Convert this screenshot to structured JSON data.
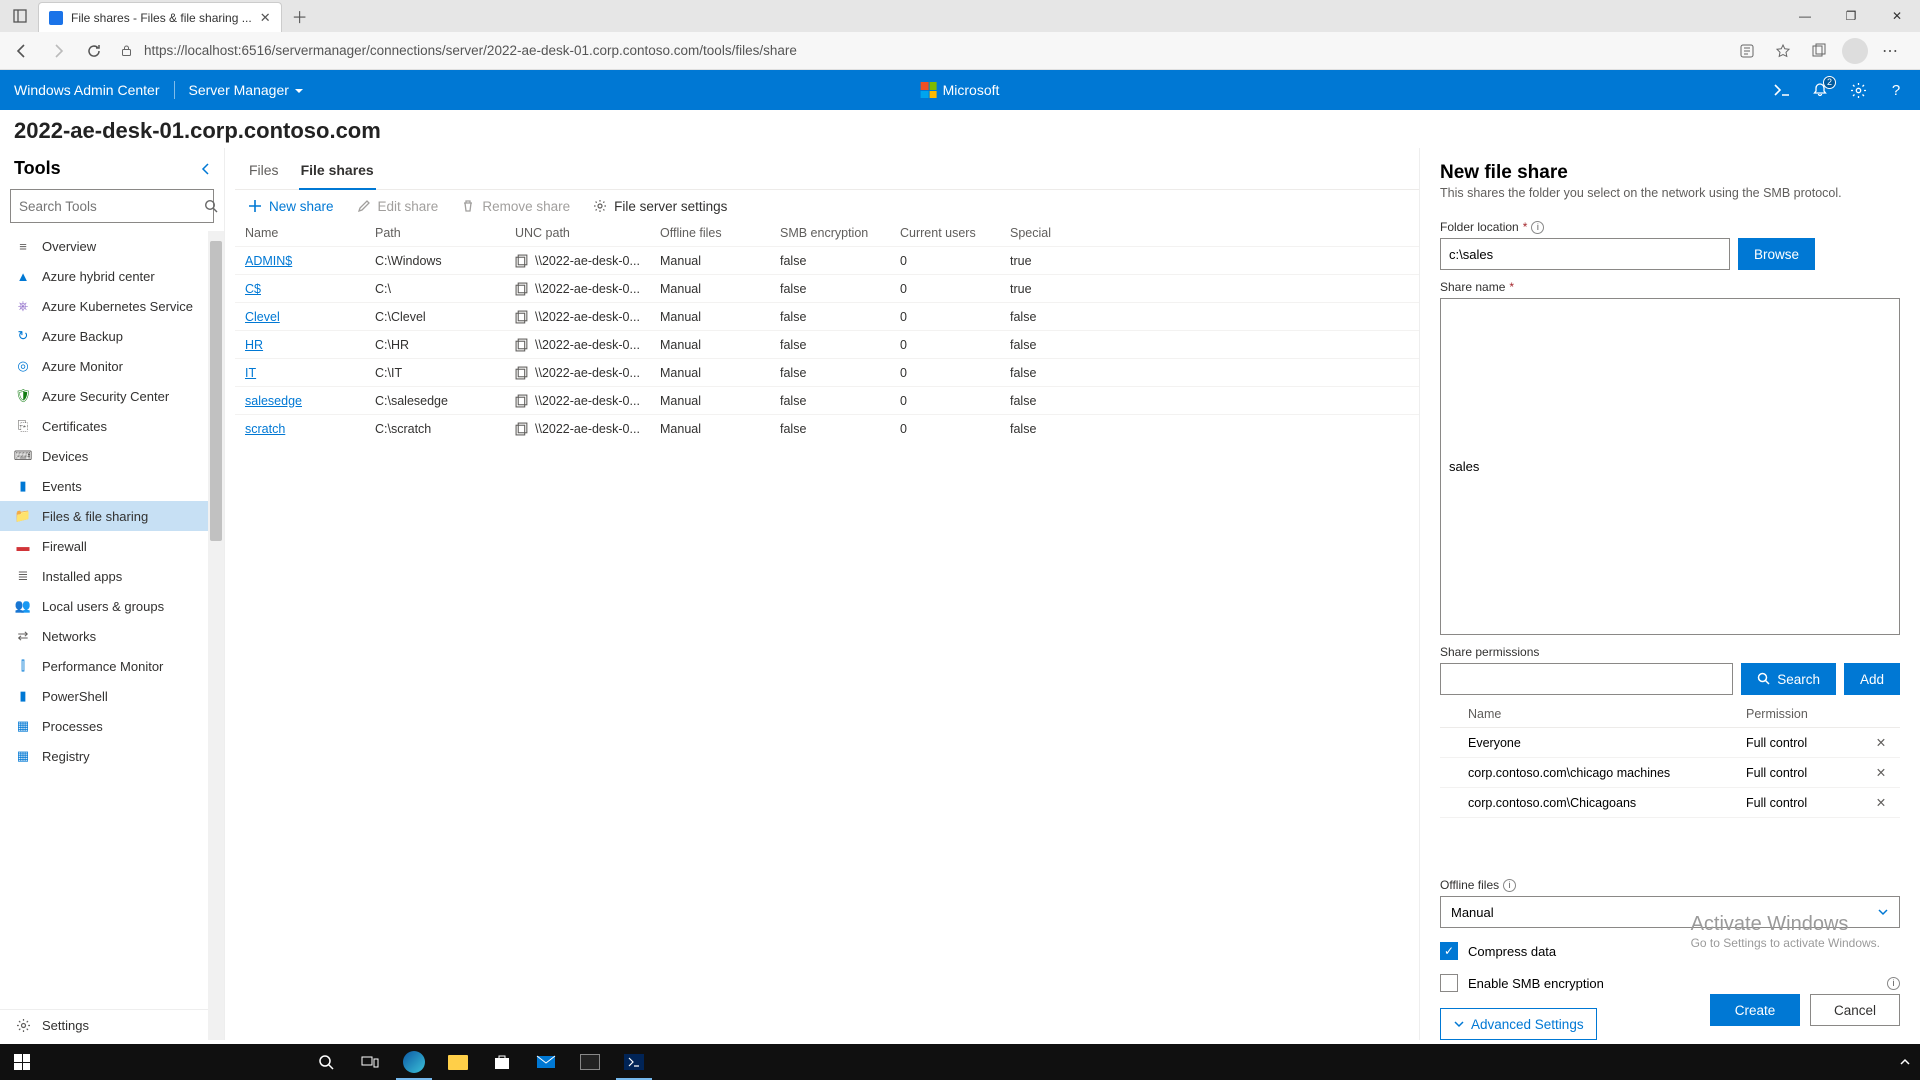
{
  "browser": {
    "tab_title": "File shares - Files & file sharing ...",
    "url": "https://localhost:6516/servermanager/connections/server/2022-ae-desk-01.corp.contoso.com/tools/files/share"
  },
  "wac": {
    "brand": "Windows Admin Center",
    "context": "Server Manager",
    "ms": "Microsoft",
    "notif_count": "2"
  },
  "page": {
    "title": "2022-ae-desk-01.corp.contoso.com"
  },
  "tools": {
    "heading": "Tools",
    "search_placeholder": "Search Tools",
    "settings": "Settings",
    "items": [
      {
        "label": "Overview",
        "icon": "≡",
        "color": "#605e5c"
      },
      {
        "label": "Azure hybrid center",
        "icon": "▲",
        "color": "#0078d4"
      },
      {
        "label": "Azure Kubernetes Service",
        "icon": "⎈",
        "color": "#8661c5"
      },
      {
        "label": "Azure Backup",
        "icon": "↻",
        "color": "#0078d4"
      },
      {
        "label": "Azure Monitor",
        "icon": "◎",
        "color": "#0078d4"
      },
      {
        "label": "Azure Security Center",
        "icon": "🛡",
        "color": "#107c10"
      },
      {
        "label": "Certificates",
        "icon": "⎘",
        "color": "#605e5c"
      },
      {
        "label": "Devices",
        "icon": "⌨",
        "color": "#605e5c"
      },
      {
        "label": "Events",
        "icon": "▮",
        "color": "#0078d4"
      },
      {
        "label": "Files & file sharing",
        "icon": "📁",
        "color": "#ffb900",
        "active": true
      },
      {
        "label": "Firewall",
        "icon": "▬",
        "color": "#d13438"
      },
      {
        "label": "Installed apps",
        "icon": "≣",
        "color": "#605e5c"
      },
      {
        "label": "Local users & groups",
        "icon": "👥",
        "color": "#0078d4"
      },
      {
        "label": "Networks",
        "icon": "⇄",
        "color": "#605e5c"
      },
      {
        "label": "Performance Monitor",
        "icon": "⫿",
        "color": "#0078d4"
      },
      {
        "label": "PowerShell",
        "icon": "▮",
        "color": "#0078d4"
      },
      {
        "label": "Processes",
        "icon": "▦",
        "color": "#0078d4"
      },
      {
        "label": "Registry",
        "icon": "▦",
        "color": "#0078d4"
      }
    ]
  },
  "subtabs": {
    "files": "Files",
    "shares": "File shares"
  },
  "cmd": {
    "new": "New share",
    "edit": "Edit share",
    "remove": "Remove share",
    "settings": "File server settings"
  },
  "tableHead": {
    "name": "Name",
    "path": "Path",
    "unc": "UNC path",
    "offline": "Offline files",
    "smb": "SMB encryption",
    "users": "Current users",
    "special": "Special"
  },
  "rows": [
    {
      "name": "ADMIN$",
      "path": "C:\\Windows",
      "unc": "\\\\2022-ae-desk-0...",
      "offline": "Manual",
      "smb": "false",
      "users": "0",
      "special": "true"
    },
    {
      "name": "C$",
      "path": "C:\\",
      "unc": "\\\\2022-ae-desk-0...",
      "offline": "Manual",
      "smb": "false",
      "users": "0",
      "special": "true"
    },
    {
      "name": "Clevel",
      "path": "C:\\Clevel",
      "unc": "\\\\2022-ae-desk-0...",
      "offline": "Manual",
      "smb": "false",
      "users": "0",
      "special": "false"
    },
    {
      "name": "HR",
      "path": "C:\\HR",
      "unc": "\\\\2022-ae-desk-0...",
      "offline": "Manual",
      "smb": "false",
      "users": "0",
      "special": "false"
    },
    {
      "name": "IT",
      "path": "C:\\IT",
      "unc": "\\\\2022-ae-desk-0...",
      "offline": "Manual",
      "smb": "false",
      "users": "0",
      "special": "false"
    },
    {
      "name": "salesedge",
      "path": "C:\\salesedge",
      "unc": "\\\\2022-ae-desk-0...",
      "offline": "Manual",
      "smb": "false",
      "users": "0",
      "special": "false"
    },
    {
      "name": "scratch",
      "path": "C:\\scratch",
      "unc": "\\\\2022-ae-desk-0...",
      "offline": "Manual",
      "smb": "false",
      "users": "0",
      "special": "false"
    }
  ],
  "fly": {
    "title": "New file share",
    "subtitle": "This shares the folder you select on the network using the SMB protocol.",
    "folder_label": "Folder location",
    "folder_value": "c:\\sales",
    "browse": "Browse",
    "name_label": "Share name",
    "name_value": "sales",
    "perm_label": "Share permissions",
    "search": "Search",
    "add": "Add",
    "col_name": "Name",
    "col_perm": "Permission",
    "perms": [
      {
        "name": "Everyone",
        "perm": "Full control"
      },
      {
        "name": "corp.contoso.com\\chicago machines",
        "perm": "Full control"
      },
      {
        "name": "corp.contoso.com\\Chicagoans",
        "perm": "Full control"
      }
    ],
    "offline_label": "Offline files",
    "offline_value": "Manual",
    "compress": "Compress data",
    "smbenc": "Enable SMB encryption",
    "advanced": "Advanced Settings",
    "create": "Create",
    "cancel": "Cancel"
  },
  "watermark": {
    "t1": "Activate Windows",
    "t2": "Go to Settings to activate Windows."
  }
}
